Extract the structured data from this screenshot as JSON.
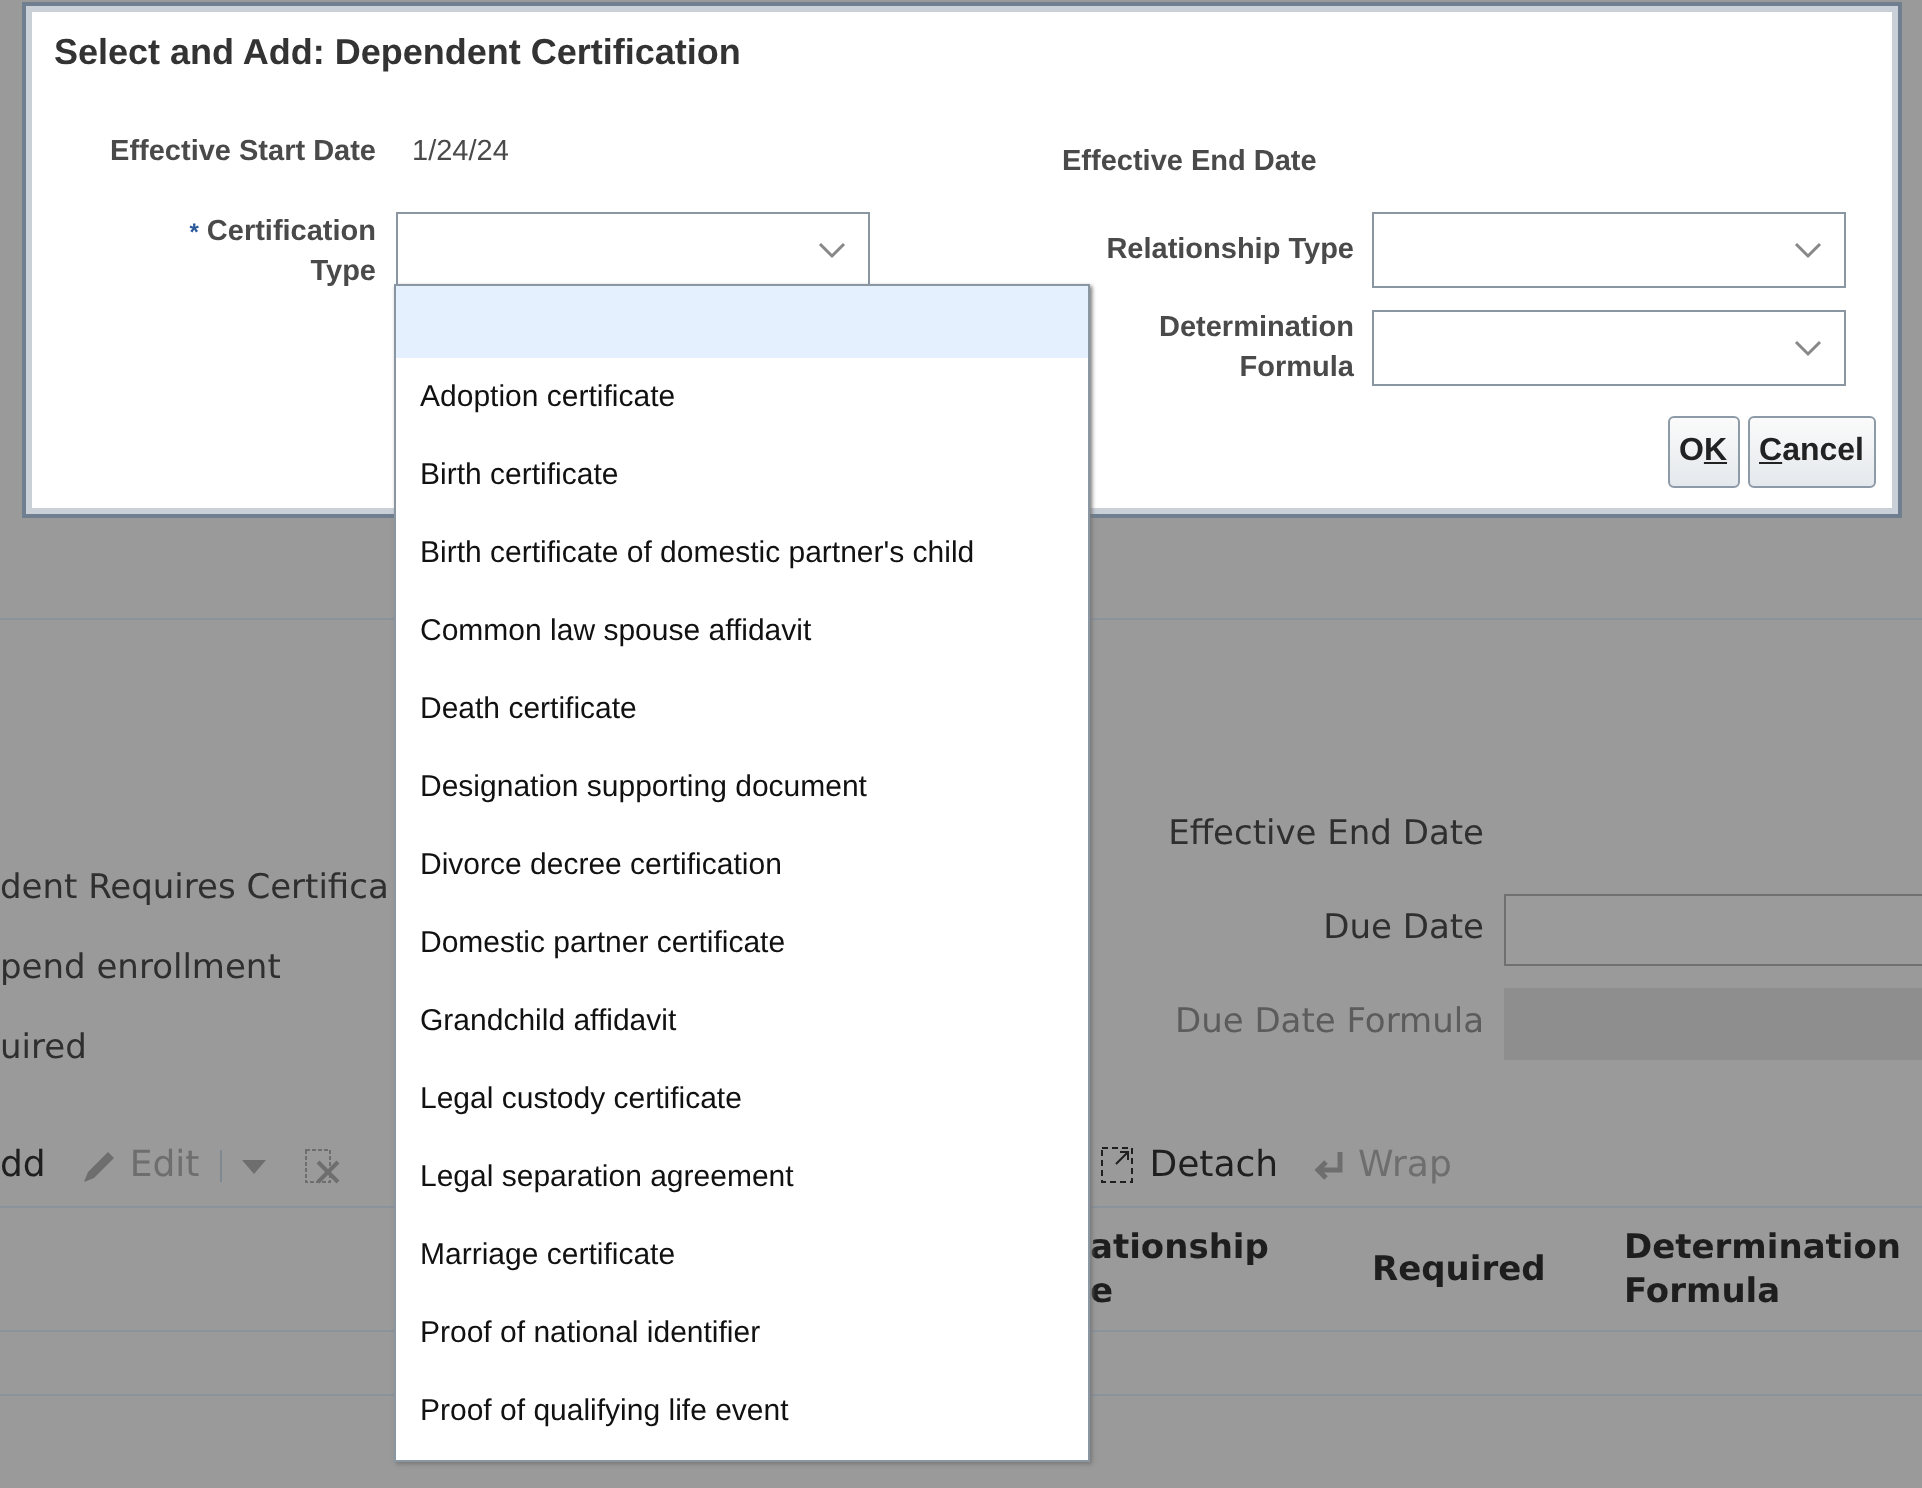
{
  "background": {
    "left_texts": [
      "dent Requires Certifica",
      "pend enrollment",
      "uired"
    ],
    "right_fields": [
      {
        "label": "Effective End Date",
        "kind": "text",
        "disabled": false
      },
      {
        "label": "Due Date",
        "kind": "input",
        "disabled": false
      },
      {
        "label": "Due Date Formula",
        "kind": "input",
        "disabled": true
      }
    ],
    "toolbar": [
      {
        "label": "dd",
        "disabled": false
      },
      {
        "label": "Edit",
        "disabled": true
      },
      {
        "disabled": true
      },
      {
        "disabled": true
      },
      {
        "label": "Detach",
        "disabled": false
      },
      {
        "label": "Wrap",
        "disabled": true
      }
    ],
    "columns": [
      "ationship\ne",
      "Required",
      "Determination\nFormula"
    ]
  },
  "dialog": {
    "title": "Select and Add: Dependent Certification",
    "left": [
      {
        "label": "Effective Start Date",
        "value": "1/24/24",
        "kind": "text"
      },
      {
        "label": "Certification Type",
        "kind": "select",
        "required_mark": "*"
      }
    ],
    "right": [
      {
        "label": "Effective End Date",
        "kind": "text"
      },
      {
        "label": "Relationship Type",
        "kind": "select"
      },
      {
        "label": "Determination Formula",
        "kind": "select"
      }
    ],
    "buttons": [
      {
        "text_before": "O",
        "access_key": "K"
      },
      {
        "access_key": "C",
        "text_after": "ancel"
      }
    ]
  },
  "dropdown": {
    "blank_option_highlighted": true,
    "options": [
      "Adoption certificate",
      "Birth certificate",
      "Birth certificate of domestic partner's child",
      "Common law spouse affidavit",
      "Death certificate",
      "Designation supporting document",
      "Divorce decree certification",
      "Domestic partner certificate",
      "Grandchild affidavit",
      "Legal custody certificate",
      "Legal separation agreement",
      "Marriage certificate",
      "Proof of national identifier",
      "Proof of qualifying life event"
    ]
  }
}
